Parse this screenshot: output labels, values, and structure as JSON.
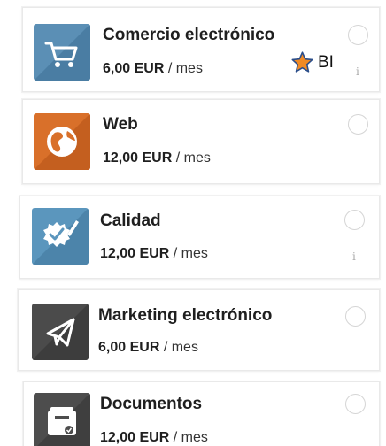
{
  "apps": [
    {
      "name": "Comercio electrónico",
      "price": "6,00 EUR",
      "period": "/ mes",
      "icon": "shopping-cart-icon",
      "icon_color": "#5b8fb5",
      "has_info": true,
      "badge": "BI"
    },
    {
      "name": "Web",
      "price": "12,00 EUR",
      "period": "/ mes",
      "icon": "globe-icon",
      "icon_color": "#d9702a",
      "has_info": false
    },
    {
      "name": "Calidad",
      "price": "12,00 EUR",
      "period": "/ mes",
      "icon": "quality-badge-icon",
      "icon_color": "#5b96bd",
      "has_info": true
    },
    {
      "name": "Marketing electrónico",
      "price": "6,00 EUR",
      "period": "/ mes",
      "icon": "paper-plane-icon",
      "icon_color": "#4b4b4b",
      "has_info": false
    },
    {
      "name": "Documentos",
      "price": "12,00 EUR",
      "period": "/ mes",
      "icon": "document-drawer-icon",
      "icon_color": "#4d4d4d",
      "has_info": false
    }
  ],
  "info_glyph": "i",
  "star_color": "#f08a24"
}
